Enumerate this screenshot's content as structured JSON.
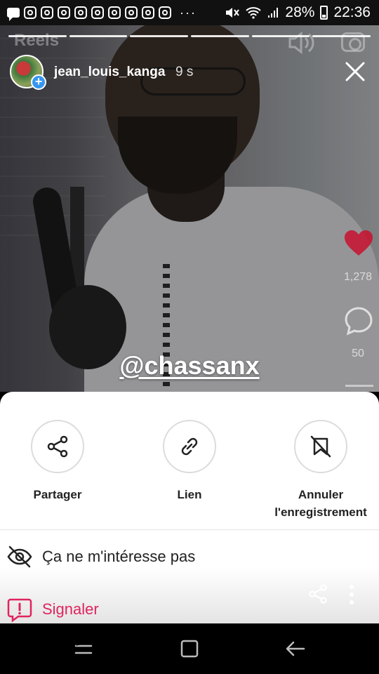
{
  "status_bar": {
    "battery": "28%",
    "time": "22:36",
    "overflow": "···"
  },
  "reel": {
    "ghost_title": "Reels",
    "username": "jean_louis_kanga",
    "time_ago": "9 s",
    "mention": "@chassanx",
    "likes": "1,278",
    "comments": "50"
  },
  "sheet": {
    "actions": [
      {
        "label": "Partager",
        "icon": "share-icon"
      },
      {
        "label": "Lien",
        "icon": "link-icon"
      },
      {
        "label": "Annuler l'enregistrement",
        "icon": "unsave-icon"
      }
    ],
    "not_interested": "Ça ne m'intéresse pas",
    "report": "Signaler"
  },
  "colors": {
    "report_red": "#e0245e",
    "plus_blue": "#3797f0",
    "like_red": "#e0245e"
  }
}
